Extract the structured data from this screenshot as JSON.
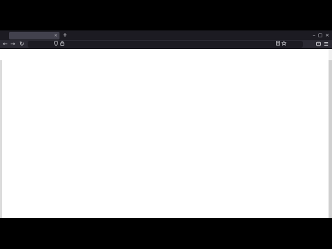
{
  "browser": {
    "tab": {
      "title": "",
      "close_glyph": "×"
    },
    "new_tab_glyph": "+",
    "window_controls": {
      "minimize": "–",
      "maximize": "▢",
      "close": "×"
    },
    "nav": {
      "back": "←",
      "forward": "→",
      "reload": "↻"
    },
    "url": {
      "value": ""
    },
    "icons": {
      "shield": "shield-icon",
      "lock": "lock-icon",
      "reader": "reader-view-icon",
      "bookmark": "star-icon",
      "extensions": "extensions-icon",
      "menu": "menu-icon"
    }
  },
  "colors": {
    "tabstrip": "#1c1b22",
    "toolbar": "#2b2a33",
    "active_tab": "#42414d",
    "page": "#ffffff"
  }
}
